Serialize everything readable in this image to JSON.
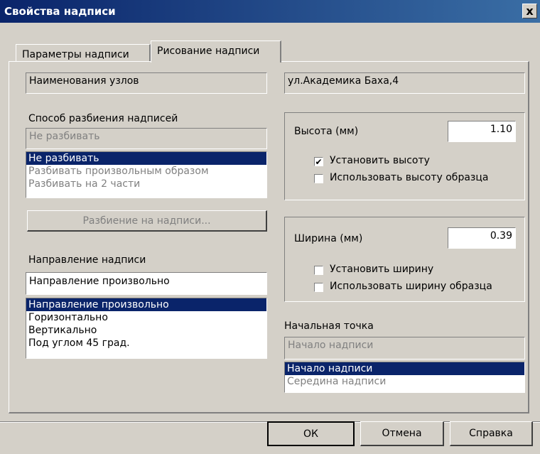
{
  "window": {
    "title": "Свойства надписи",
    "close_label": "x"
  },
  "tabs": [
    {
      "label": "Параметры надписи",
      "active": false
    },
    {
      "label": "Рисование надписи",
      "active": true
    }
  ],
  "left": {
    "layer_value": "Наименования узлов",
    "split": {
      "label": "Способ разбиения надписей",
      "value": "Не разбивать",
      "options": [
        "Не разбивать",
        "Разбивать произвольным образом",
        "Разбивать на 2 части"
      ],
      "selected_index": 0,
      "button_label": "Разбиение на надписи..."
    },
    "direction": {
      "label": "Направление надписи",
      "value": "Направление произвольно",
      "options": [
        "Направление произвольно",
        "Горизонтально",
        "Вертикально",
        "Под углом 45 град."
      ],
      "selected_index": 0
    }
  },
  "right": {
    "text_value": "ул.Академика Баха,4",
    "height": {
      "label": "Высота (мм)",
      "value": "1.10",
      "set_label": "Установить высоту",
      "set_checked": true,
      "use_sample_label": "Использовать высоту образца",
      "use_sample_checked": false
    },
    "width": {
      "label": "Ширина (мм)",
      "value": "0.39",
      "set_label": "Установить ширину",
      "set_checked": false,
      "use_sample_label": "Использовать ширину образца",
      "use_sample_checked": false
    },
    "start_point": {
      "label": "Начальная точка",
      "value": "Начало надписи",
      "options": [
        "Начало надписи",
        "Середина надписи"
      ],
      "selected_index": 0
    }
  },
  "buttons": {
    "ok": "ОК",
    "cancel": "Отмена",
    "help": "Справка"
  },
  "check_glyph": "✔",
  "colors": {
    "title_bar": "#0a246a",
    "dialog_bg": "#d4d0c8",
    "selection": "#0a246a"
  }
}
